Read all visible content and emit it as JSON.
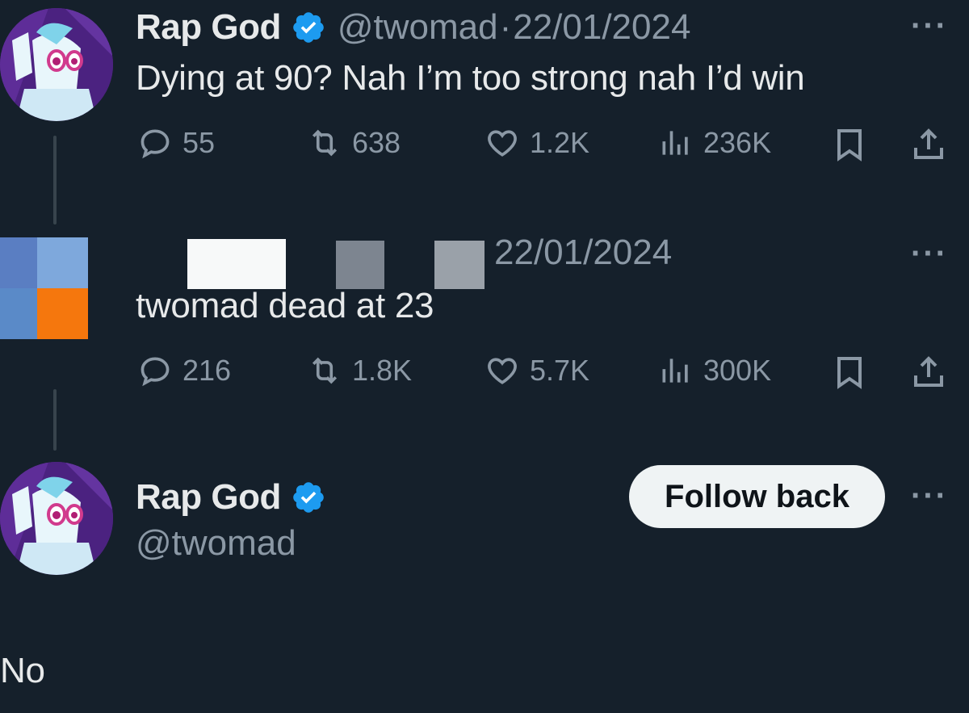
{
  "tweet1": {
    "name": "Rap God",
    "handle": "@twomad",
    "separator": "·",
    "date": "22/01/2024",
    "text": "Dying at 90? Nah I’m too strong nah I’d win",
    "stats": {
      "replies": "55",
      "reposts": "638",
      "likes": "1.2K",
      "views": "236K"
    },
    "more": "···"
  },
  "tweet2": {
    "date": "22/01/2024",
    "text": "twomad dead at 23",
    "stats": {
      "replies": "216",
      "reposts": "1.8K",
      "likes": "5.7K",
      "views": "300K"
    },
    "more": "···"
  },
  "reply": {
    "name": "Rap God",
    "handle": "@twomad",
    "follow_label": "Follow back",
    "text": "No",
    "more": "···"
  },
  "colors": {
    "background": "#15202b",
    "verified": "#1d9bf0",
    "muted": "#8b98a5",
    "accent_orange": "#f5770d"
  }
}
